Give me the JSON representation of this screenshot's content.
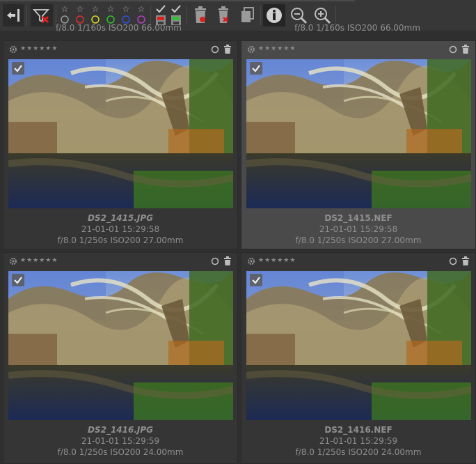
{
  "toolbar": {
    "buttons": [
      {
        "name": "collapse-panel-icon"
      },
      {
        "name": "filter-remove-icon"
      },
      {
        "name": "rating-0-icon"
      },
      {
        "name": "rating-1-icon"
      },
      {
        "name": "rating-2-icon"
      },
      {
        "name": "rating-3-icon"
      },
      {
        "name": "rating-4-icon"
      },
      {
        "name": "rating-5-icon"
      },
      {
        "name": "mark-edited-icon"
      },
      {
        "name": "mark-saved-icon"
      },
      {
        "name": "trash-icon"
      },
      {
        "name": "delete-icon"
      },
      {
        "name": "copy-icon"
      },
      {
        "name": "info-icon"
      },
      {
        "name": "zoom-out-icon"
      },
      {
        "name": "zoom-in-icon"
      }
    ],
    "rating_colors": [
      "#9a9a9a",
      "#e03030",
      "#d8d820",
      "#30c030",
      "#3050e0",
      "#b040c0"
    ]
  },
  "top_partial_caption": "f/8.0 1/160s ISO200 66.00mm",
  "thumbnails": [
    {
      "filename": "DS2_1415.JPG",
      "datetime": "21-01-01 15:29:58",
      "exif": "f/8.0 1/250s ISO200 27.00mm",
      "italic": true,
      "selected": false
    },
    {
      "filename": "DS2_1415.NEF",
      "datetime": "21-01-01 15:29:58",
      "exif": "f/8.0 1/250s ISO200 27.00mm",
      "italic": false,
      "selected": true
    },
    {
      "filename": "DS2_1416.JPG",
      "datetime": "21-01-01 15:29:59",
      "exif": "f/8.0 1/250s ISO200 24.00mm",
      "italic": true,
      "selected": false
    },
    {
      "filename": "DS2_1416.NEF",
      "datetime": "21-01-01 15:29:59",
      "exif": "f/8.0 1/250s ISO200 24.00mm",
      "italic": false,
      "selected": false
    }
  ],
  "stars": "★★★★★★"
}
